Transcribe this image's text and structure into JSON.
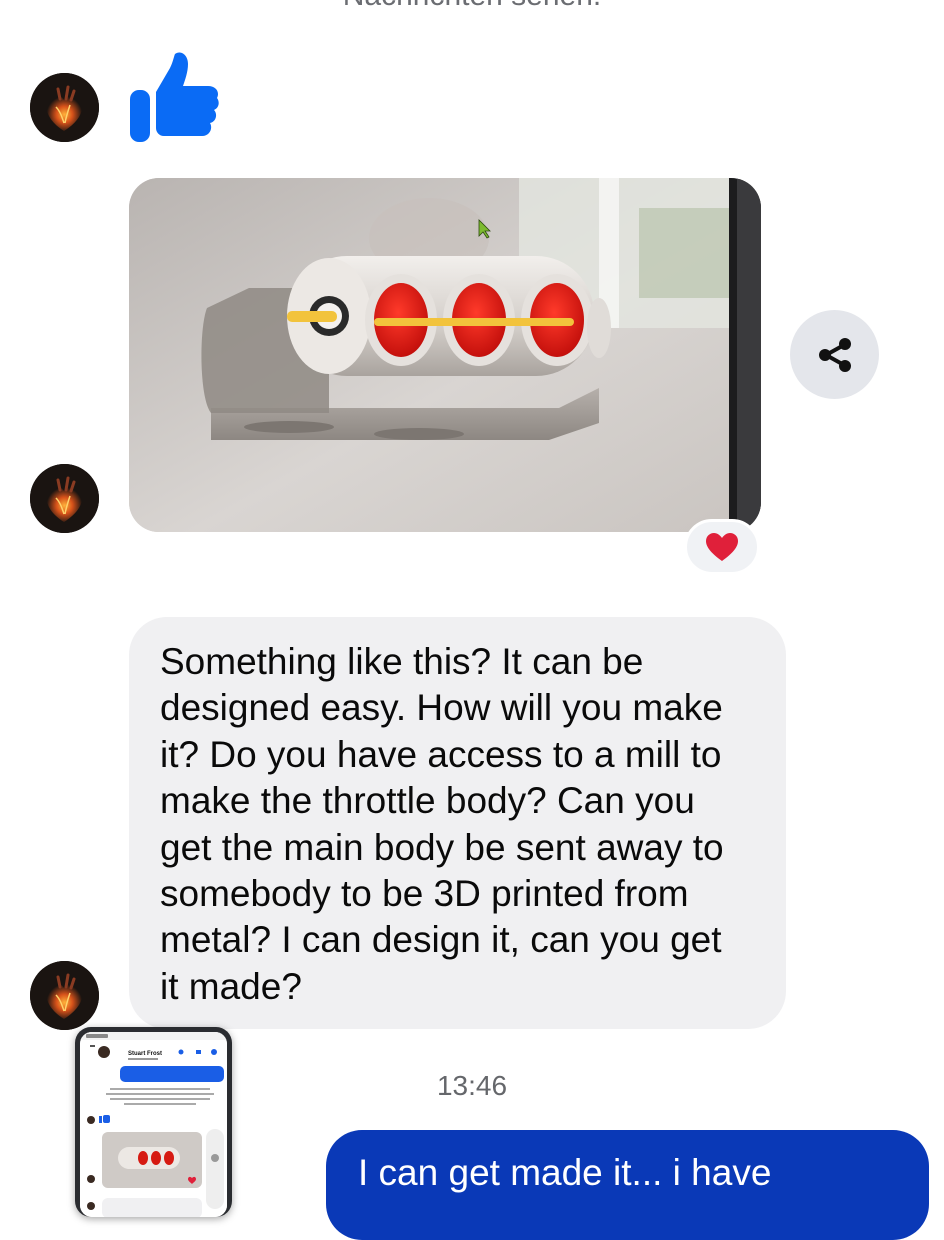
{
  "thread": {
    "notice_text": "Nachrichten sehen.",
    "timestamp": "13:46"
  },
  "messages": {
    "incoming_text": "Something like this? It can be\ndesigned easy. How will you make\nit? Do you have access to a mill to\nmake the throttle body? Can you\nget the main body be sent away to\nsomebody to be 3D printed from\nmetal? I can design it, can you get\nit made?",
    "outgoing_text": "I can get made it... i have",
    "reaction_emoji": "heart"
  },
  "pip_preview": {
    "contact_name": "Stuart Frost"
  },
  "icons": {
    "like": "thumbs-up-icon",
    "share": "share-icon",
    "reaction": "heart-icon",
    "avatar": "anatomical-heart-avatar"
  },
  "colors": {
    "like_blue": "#0a6bf5",
    "outgoing_bubble": "#0a39b7",
    "incoming_bubble": "#f0f0f2",
    "reaction_red": "#e0203a"
  }
}
